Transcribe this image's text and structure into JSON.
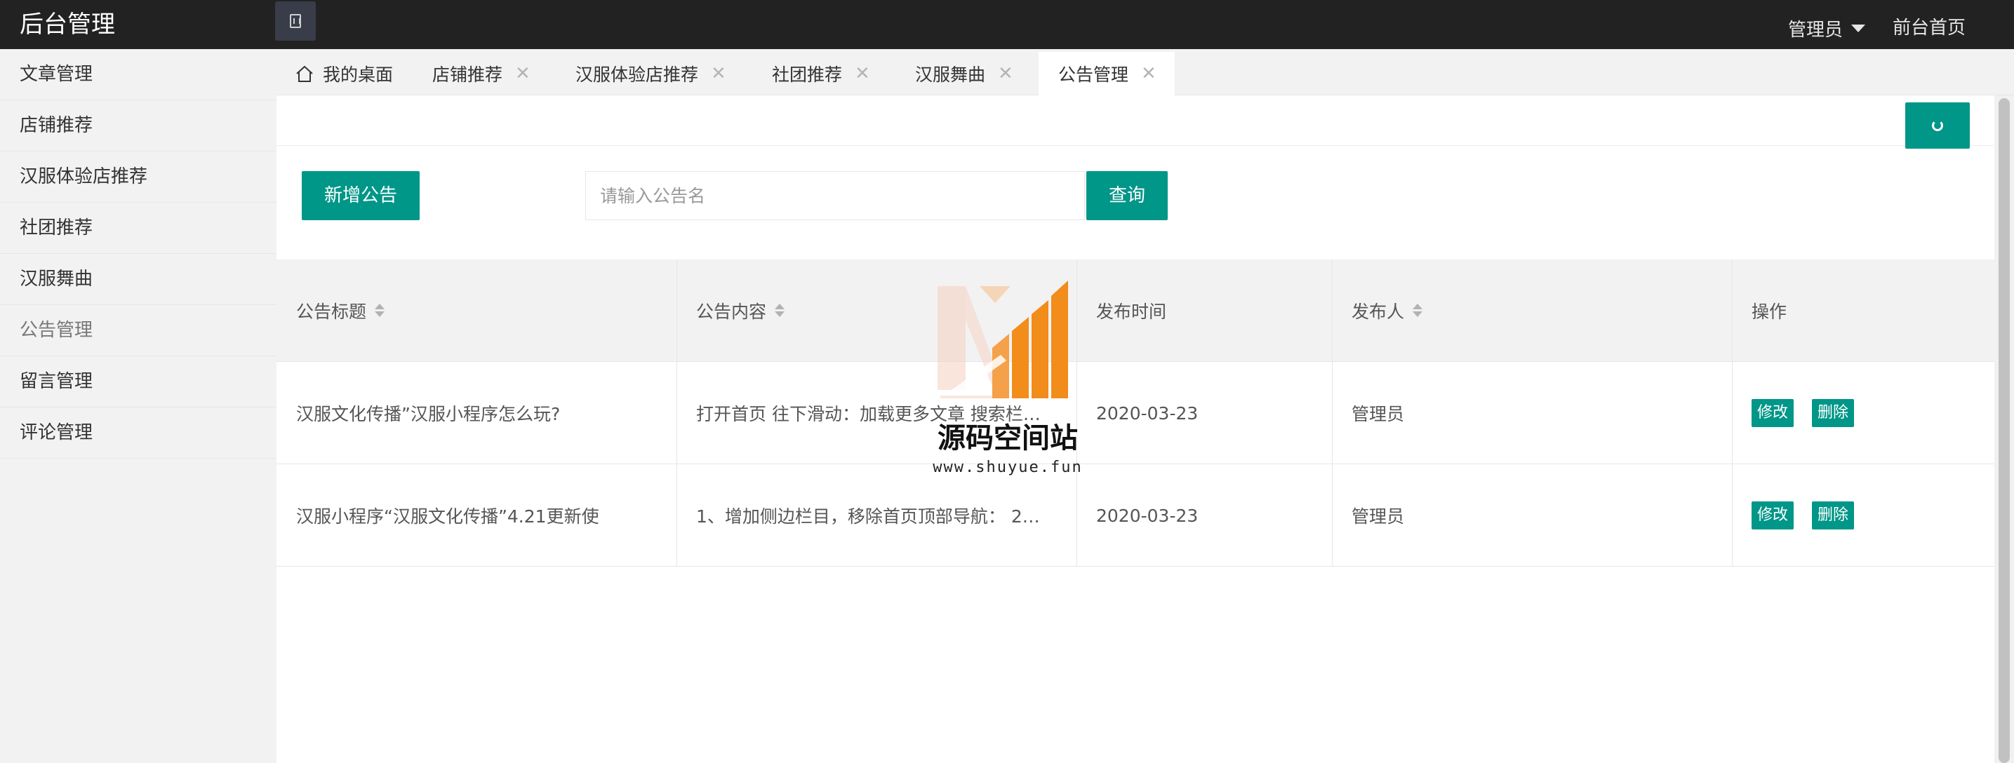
{
  "header": {
    "logo": "后台管理",
    "admin_label": "管理员",
    "front_link": "前台首页"
  },
  "sidebar": {
    "items": [
      {
        "label": "文章管理"
      },
      {
        "label": "店铺推荐"
      },
      {
        "label": "汉服体验店推荐"
      },
      {
        "label": "社团推荐"
      },
      {
        "label": "汉服舞曲"
      },
      {
        "label": "公告管理",
        "active": true
      },
      {
        "label": "留言管理"
      },
      {
        "label": "评论管理"
      }
    ]
  },
  "tabs": [
    {
      "label": "我的桌面",
      "icon": "home-icon"
    },
    {
      "label": "店铺推荐",
      "closable": true
    },
    {
      "label": "汉服体验店推荐",
      "closable": true
    },
    {
      "label": "社团推荐",
      "closable": true
    },
    {
      "label": "汉服舞曲",
      "closable": true
    },
    {
      "label": "公告管理",
      "closable": true,
      "active": true
    }
  ],
  "tab_close_glyph": "✕",
  "toolbar": {
    "add_label": "新增公告",
    "search_placeholder": "请输入公告名",
    "query_label": "查询"
  },
  "table": {
    "columns": [
      "公告标题",
      "公告内容",
      "发布时间",
      "发布人",
      "操作"
    ],
    "rows": [
      {
        "title": "汉服文化传播”汉服小程序怎么玩?",
        "content": "打开首页 往下滑动：加载更多文章 搜索栏…",
        "date": "2020-03-23",
        "author": "管理员"
      },
      {
        "title": "汉服小程序“汉服文化传播”4.21更新使",
        "content": "1、增加侧边栏目，移除首页顶部导航： 2…",
        "date": "2020-03-23",
        "author": "管理员"
      }
    ],
    "edit_label": "修改",
    "delete_label": "删除"
  },
  "watermark": {
    "title": "源码空间站",
    "url": "www.shuyue.fun"
  },
  "colors": {
    "accent": "#009688",
    "header_bg": "#222222",
    "watermark_orange": "#f28c1a"
  }
}
